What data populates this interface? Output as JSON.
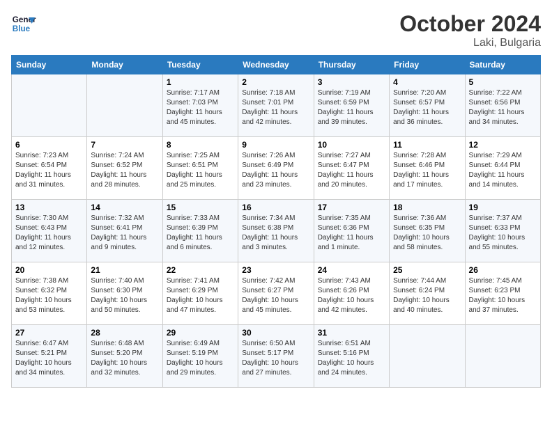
{
  "header": {
    "logo_line1": "General",
    "logo_line2": "Blue",
    "month": "October 2024",
    "location": "Laki, Bulgaria"
  },
  "weekdays": [
    "Sunday",
    "Monday",
    "Tuesday",
    "Wednesday",
    "Thursday",
    "Friday",
    "Saturday"
  ],
  "weeks": [
    [
      {
        "day": "",
        "sunrise": "",
        "sunset": "",
        "daylight": ""
      },
      {
        "day": "",
        "sunrise": "",
        "sunset": "",
        "daylight": ""
      },
      {
        "day": "1",
        "sunrise": "Sunrise: 7:17 AM",
        "sunset": "Sunset: 7:03 PM",
        "daylight": "Daylight: 11 hours and 45 minutes."
      },
      {
        "day": "2",
        "sunrise": "Sunrise: 7:18 AM",
        "sunset": "Sunset: 7:01 PM",
        "daylight": "Daylight: 11 hours and 42 minutes."
      },
      {
        "day": "3",
        "sunrise": "Sunrise: 7:19 AM",
        "sunset": "Sunset: 6:59 PM",
        "daylight": "Daylight: 11 hours and 39 minutes."
      },
      {
        "day": "4",
        "sunrise": "Sunrise: 7:20 AM",
        "sunset": "Sunset: 6:57 PM",
        "daylight": "Daylight: 11 hours and 36 minutes."
      },
      {
        "day": "5",
        "sunrise": "Sunrise: 7:22 AM",
        "sunset": "Sunset: 6:56 PM",
        "daylight": "Daylight: 11 hours and 34 minutes."
      }
    ],
    [
      {
        "day": "6",
        "sunrise": "Sunrise: 7:23 AM",
        "sunset": "Sunset: 6:54 PM",
        "daylight": "Daylight: 11 hours and 31 minutes."
      },
      {
        "day": "7",
        "sunrise": "Sunrise: 7:24 AM",
        "sunset": "Sunset: 6:52 PM",
        "daylight": "Daylight: 11 hours and 28 minutes."
      },
      {
        "day": "8",
        "sunrise": "Sunrise: 7:25 AM",
        "sunset": "Sunset: 6:51 PM",
        "daylight": "Daylight: 11 hours and 25 minutes."
      },
      {
        "day": "9",
        "sunrise": "Sunrise: 7:26 AM",
        "sunset": "Sunset: 6:49 PM",
        "daylight": "Daylight: 11 hours and 23 minutes."
      },
      {
        "day": "10",
        "sunrise": "Sunrise: 7:27 AM",
        "sunset": "Sunset: 6:47 PM",
        "daylight": "Daylight: 11 hours and 20 minutes."
      },
      {
        "day": "11",
        "sunrise": "Sunrise: 7:28 AM",
        "sunset": "Sunset: 6:46 PM",
        "daylight": "Daylight: 11 hours and 17 minutes."
      },
      {
        "day": "12",
        "sunrise": "Sunrise: 7:29 AM",
        "sunset": "Sunset: 6:44 PM",
        "daylight": "Daylight: 11 hours and 14 minutes."
      }
    ],
    [
      {
        "day": "13",
        "sunrise": "Sunrise: 7:30 AM",
        "sunset": "Sunset: 6:43 PM",
        "daylight": "Daylight: 11 hours and 12 minutes."
      },
      {
        "day": "14",
        "sunrise": "Sunrise: 7:32 AM",
        "sunset": "Sunset: 6:41 PM",
        "daylight": "Daylight: 11 hours and 9 minutes."
      },
      {
        "day": "15",
        "sunrise": "Sunrise: 7:33 AM",
        "sunset": "Sunset: 6:39 PM",
        "daylight": "Daylight: 11 hours and 6 minutes."
      },
      {
        "day": "16",
        "sunrise": "Sunrise: 7:34 AM",
        "sunset": "Sunset: 6:38 PM",
        "daylight": "Daylight: 11 hours and 3 minutes."
      },
      {
        "day": "17",
        "sunrise": "Sunrise: 7:35 AM",
        "sunset": "Sunset: 6:36 PM",
        "daylight": "Daylight: 11 hours and 1 minute."
      },
      {
        "day": "18",
        "sunrise": "Sunrise: 7:36 AM",
        "sunset": "Sunset: 6:35 PM",
        "daylight": "Daylight: 10 hours and 58 minutes."
      },
      {
        "day": "19",
        "sunrise": "Sunrise: 7:37 AM",
        "sunset": "Sunset: 6:33 PM",
        "daylight": "Daylight: 10 hours and 55 minutes."
      }
    ],
    [
      {
        "day": "20",
        "sunrise": "Sunrise: 7:38 AM",
        "sunset": "Sunset: 6:32 PM",
        "daylight": "Daylight: 10 hours and 53 minutes."
      },
      {
        "day": "21",
        "sunrise": "Sunrise: 7:40 AM",
        "sunset": "Sunset: 6:30 PM",
        "daylight": "Daylight: 10 hours and 50 minutes."
      },
      {
        "day": "22",
        "sunrise": "Sunrise: 7:41 AM",
        "sunset": "Sunset: 6:29 PM",
        "daylight": "Daylight: 10 hours and 47 minutes."
      },
      {
        "day": "23",
        "sunrise": "Sunrise: 7:42 AM",
        "sunset": "Sunset: 6:27 PM",
        "daylight": "Daylight: 10 hours and 45 minutes."
      },
      {
        "day": "24",
        "sunrise": "Sunrise: 7:43 AM",
        "sunset": "Sunset: 6:26 PM",
        "daylight": "Daylight: 10 hours and 42 minutes."
      },
      {
        "day": "25",
        "sunrise": "Sunrise: 7:44 AM",
        "sunset": "Sunset: 6:24 PM",
        "daylight": "Daylight: 10 hours and 40 minutes."
      },
      {
        "day": "26",
        "sunrise": "Sunrise: 7:45 AM",
        "sunset": "Sunset: 6:23 PM",
        "daylight": "Daylight: 10 hours and 37 minutes."
      }
    ],
    [
      {
        "day": "27",
        "sunrise": "Sunrise: 6:47 AM",
        "sunset": "Sunset: 5:21 PM",
        "daylight": "Daylight: 10 hours and 34 minutes."
      },
      {
        "day": "28",
        "sunrise": "Sunrise: 6:48 AM",
        "sunset": "Sunset: 5:20 PM",
        "daylight": "Daylight: 10 hours and 32 minutes."
      },
      {
        "day": "29",
        "sunrise": "Sunrise: 6:49 AM",
        "sunset": "Sunset: 5:19 PM",
        "daylight": "Daylight: 10 hours and 29 minutes."
      },
      {
        "day": "30",
        "sunrise": "Sunrise: 6:50 AM",
        "sunset": "Sunset: 5:17 PM",
        "daylight": "Daylight: 10 hours and 27 minutes."
      },
      {
        "day": "31",
        "sunrise": "Sunrise: 6:51 AM",
        "sunset": "Sunset: 5:16 PM",
        "daylight": "Daylight: 10 hours and 24 minutes."
      },
      {
        "day": "",
        "sunrise": "",
        "sunset": "",
        "daylight": ""
      },
      {
        "day": "",
        "sunrise": "",
        "sunset": "",
        "daylight": ""
      }
    ]
  ]
}
